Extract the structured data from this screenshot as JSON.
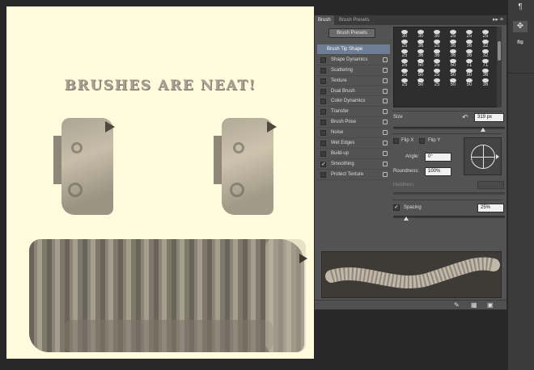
{
  "canvas": {
    "title": "BRUSHES ARE NEAT!"
  },
  "panel": {
    "tabs": [
      "Brush",
      "Brush Presets"
    ],
    "menu_glyph": "▸▸ ≡",
    "presets_button": "Brush Presets",
    "options": [
      {
        "label": "Brush Tip Shape",
        "selected": true,
        "checked": false,
        "lock": false
      },
      {
        "label": "Shape Dynamics",
        "selected": false,
        "checked": false,
        "lock": true
      },
      {
        "label": "Scattering",
        "selected": false,
        "checked": false,
        "lock": true
      },
      {
        "label": "Texture",
        "selected": false,
        "checked": false,
        "lock": true
      },
      {
        "label": "Dual Brush",
        "selected": false,
        "checked": false,
        "lock": true
      },
      {
        "label": "Color Dynamics",
        "selected": false,
        "checked": false,
        "lock": true
      },
      {
        "label": "Transfer",
        "selected": false,
        "checked": false,
        "lock": true
      },
      {
        "label": "Brush Pose",
        "selected": false,
        "checked": false,
        "lock": true
      },
      {
        "label": "Noise",
        "selected": false,
        "checked": false,
        "lock": true
      },
      {
        "label": "Wet Edges",
        "selected": false,
        "checked": false,
        "lock": true
      },
      {
        "label": "Build-up",
        "selected": false,
        "checked": false,
        "lock": true
      },
      {
        "label": "Smoothing",
        "selected": false,
        "checked": true,
        "lock": true
      },
      {
        "label": "Protect Texture",
        "selected": false,
        "checked": false,
        "lock": true
      }
    ],
    "tips": [
      "30",
      "30",
      "30",
      "25",
      "25",
      "25",
      "25",
      "36",
      "25",
      "36",
      "36",
      "32",
      "25",
      "36",
      "36",
      "36",
      "36",
      "32",
      "25",
      "50",
      "25",
      "50",
      "71",
      "71",
      "25",
      "50",
      "25",
      "50",
      "50",
      "36",
      "25",
      "50",
      "25",
      "50",
      "50",
      "36"
    ],
    "size": {
      "label": "Size",
      "value": "319 px",
      "reset_icon": "↶"
    },
    "flip_x": "Flip X",
    "flip_y": "Flip Y",
    "angle": {
      "label": "Angle:",
      "value": "0°"
    },
    "roundness": {
      "label": "Roundness:",
      "value": "100%"
    },
    "hardness": {
      "label": "Hardness"
    },
    "spacing": {
      "label": "Spacing",
      "value": "25%",
      "checked": true
    },
    "footer_icons": [
      "brush-icon",
      "grid-icon",
      "new-icon"
    ]
  },
  "right_strip": {
    "icons": [
      "¶",
      "✥",
      "⇋"
    ]
  },
  "colors": {
    "canvas": "#fffbdc",
    "panel": "#535353",
    "selected": "#6d7d96"
  }
}
